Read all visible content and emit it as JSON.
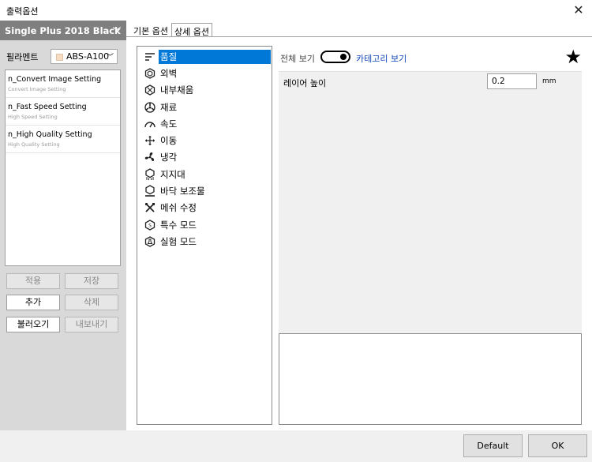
{
  "window": {
    "title": "출력옵션"
  },
  "left_panel": {
    "printer_name": "Single Plus 2018 Black",
    "filament_label": "필라멘트",
    "filament_value": "ABS-A100",
    "profiles": [
      {
        "name": "n_Convert Image Setting",
        "sub": "Convert Image Setting"
      },
      {
        "name": "n_Fast Speed Setting",
        "sub": "High Speed Setting"
      },
      {
        "name": "n_High Quality Setting",
        "sub": "High Quality Setting"
      }
    ],
    "buttons": {
      "apply": "적용",
      "save": "저장",
      "add": "추가",
      "delete": "삭제",
      "import": "불러오기",
      "export": "내보내기"
    }
  },
  "tabs": [
    {
      "label": "기본 옵션"
    },
    {
      "label": "상세 옵션"
    }
  ],
  "categories": [
    {
      "label": "품질",
      "icon": "quality-lines-icon"
    },
    {
      "label": "외벽",
      "icon": "hexagon-icon"
    },
    {
      "label": "내부채움",
      "icon": "infill-hexagon-icon"
    },
    {
      "label": "재료",
      "icon": "material-spool-icon"
    },
    {
      "label": "속도",
      "icon": "speedometer-icon"
    },
    {
      "label": "이동",
      "icon": "move-arrows-icon"
    },
    {
      "label": "냉각",
      "icon": "fan-icon"
    },
    {
      "label": "지지대",
      "icon": "support-icon"
    },
    {
      "label": "바닥 보조물",
      "icon": "bed-adhesion-icon"
    },
    {
      "label": "메쉬 수정",
      "icon": "mesh-tools-icon"
    },
    {
      "label": "특수 모드",
      "icon": "special-mode-icon"
    },
    {
      "label": "실험 모드",
      "icon": "experimental-icon"
    }
  ],
  "settings_panel": {
    "view_all_label": "전체 보기",
    "view_category_label": "카테고리 보기",
    "layer_height_label": "레이어 높이",
    "layer_height_value": "0.2",
    "layer_height_unit": "mm"
  },
  "footer": {
    "default_label": "Default",
    "ok_label": "OK"
  }
}
